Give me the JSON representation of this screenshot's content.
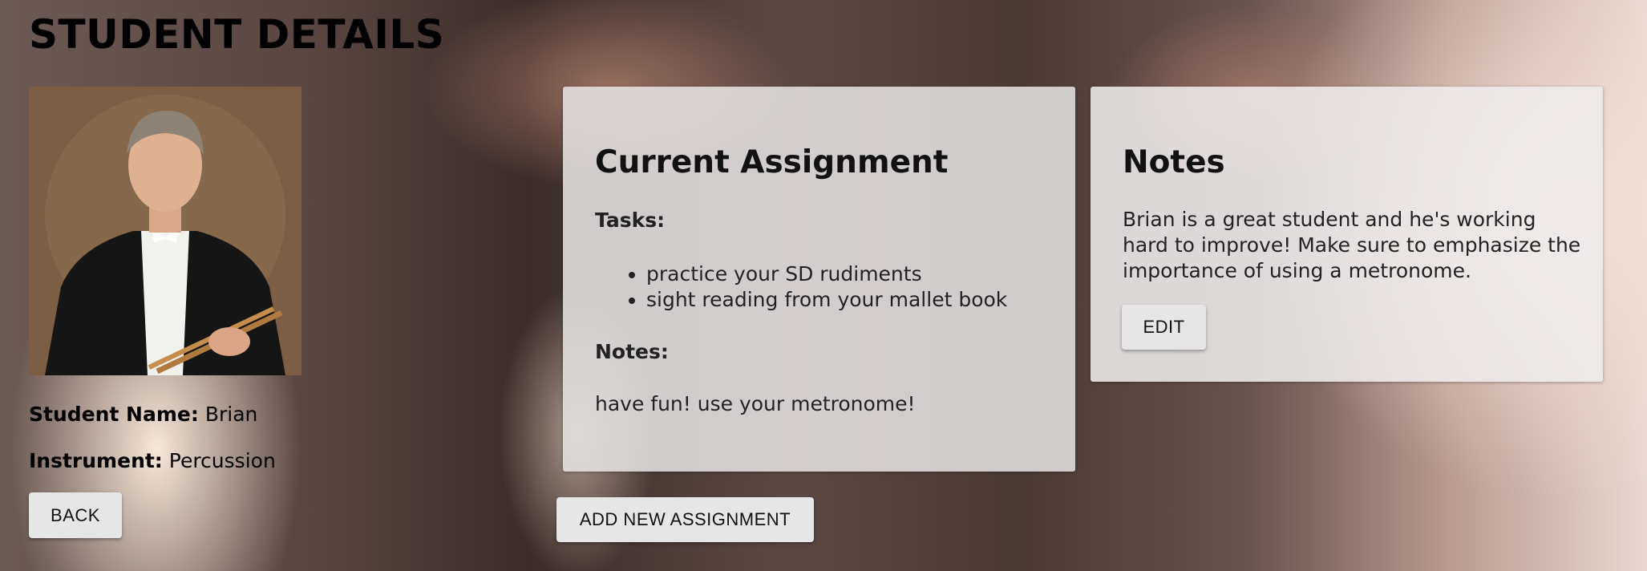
{
  "page": {
    "title": "STUDENT DETAILS"
  },
  "student": {
    "name_label": "Student Name:",
    "name": "Brian",
    "instrument_label": "Instrument:",
    "instrument": "Percussion"
  },
  "buttons": {
    "back": "BACK",
    "add_assignment": "ADD NEW ASSIGNMENT",
    "edit": "EDIT"
  },
  "assignment": {
    "heading": "Current Assignment",
    "tasks_label": "Tasks:",
    "tasks": [
      "practice your SD rudiments",
      "sight reading from your mallet book"
    ],
    "notes_label": "Notes:",
    "notes": "have fun! use your metronome!"
  },
  "notes_card": {
    "heading": "Notes",
    "text": "Brian is a great student and he's working hard to improve! Make sure to emphasize the importance of using a metronome."
  }
}
